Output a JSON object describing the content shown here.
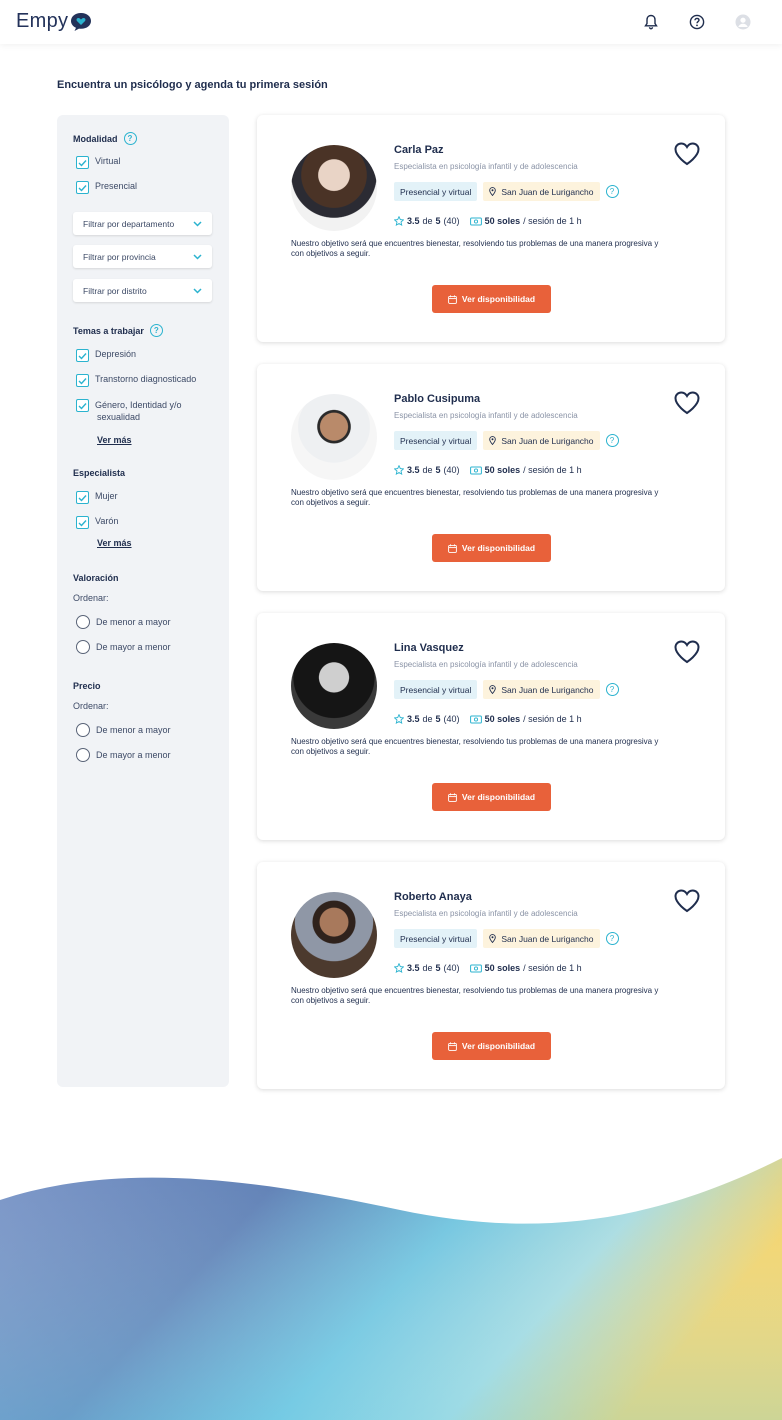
{
  "header": {
    "logo": "Empy"
  },
  "page_title": "Encuentra un psicólogo y agenda tu primera sesión",
  "filters": {
    "modalidad": {
      "label": "Modalidad",
      "options": [
        "Virtual",
        "Presencial"
      ]
    },
    "selects": [
      "Filtrar por departamento",
      "Filtrar por provincia",
      "Filtrar por distrito"
    ],
    "temas": {
      "label": "Temas a trabajar",
      "options": [
        "Depresión",
        "Transtorno diagnosticado",
        "Género, Identidad y/o",
        "sexualidad"
      ],
      "more": "Ver más"
    },
    "especialista": {
      "label": "Especialista",
      "options": [
        "Mujer",
        "Varón"
      ],
      "more": "Ver más"
    },
    "valoracion": {
      "label": "Valoración",
      "order_label": "Ordenar:",
      "options": [
        "De menor a mayor",
        "De mayor a menor"
      ]
    },
    "precio": {
      "label": "Precio",
      "order_label": "Ordenar:",
      "options": [
        "De menor a mayor",
        "De mayor a menor"
      ]
    }
  },
  "cards": [
    {
      "name": "Carla Paz",
      "specialty": "Especialista en psicología infantil y de adolescencia",
      "modality": "Presencial y virtual",
      "location": "San Juan de Lurigancho",
      "rating": "3.5",
      "of": "de",
      "max": "5",
      "reviews": "(40)",
      "price": "50 soles",
      "per": "/ sesión de 1 h",
      "description": "Nuestro objetivo será que encuentres bienestar, resolviendo tus problemas de una manera progresiva y con objetivos a seguir.",
      "button": "Ver disponibilidad"
    },
    {
      "name": "Pablo Cusipuma",
      "specialty": "Especialista en psicología infantil y de adolescencia",
      "modality": "Presencial y virtual",
      "location": "San Juan de Lurigancho",
      "rating": "3.5",
      "of": "de",
      "max": "5",
      "reviews": "(40)",
      "price": "50 soles",
      "per": "/ sesión de 1 h",
      "description": "Nuestro objetivo será que encuentres bienestar, resolviendo tus problemas de una manera progresiva y con objetivos a seguir.",
      "button": "Ver disponibilidad"
    },
    {
      "name": "Lina Vasquez",
      "specialty": "Especialista en psicología infantil y de adolescencia",
      "modality": "Presencial y virtual",
      "location": "San Juan de Lurigancho",
      "rating": "3.5",
      "of": "de",
      "max": "5",
      "reviews": "(40)",
      "price": "50 soles",
      "per": "/ sesión de 1 h",
      "description": "Nuestro objetivo será que encuentres bienestar, resolviendo tus problemas de una manera progresiva y con objetivos a seguir.",
      "button": "Ver disponibilidad"
    },
    {
      "name": "Roberto Anaya",
      "specialty": "Especialista en psicología infantil y de adolescencia",
      "modality": "Presencial y virtual",
      "location": "San Juan de Lurigancho",
      "rating": "3.5",
      "of": "de",
      "max": "5",
      "reviews": "(40)",
      "price": "50 soles",
      "per": "/ sesión de 1 h",
      "description": "Nuestro objetivo será que encuentres bienestar, resolviendo tus problemas de una manera progresiva y con objetivos a seguir.",
      "button": "Ver disponibilidad"
    }
  ],
  "icons": [
    "bell-icon",
    "help-icon",
    "user-avatar-icon",
    "check-icon",
    "chevron-down-icon",
    "star-icon",
    "money-icon",
    "location-pin-icon",
    "calendar-icon",
    "heart-icon"
  ],
  "colors": {
    "accent": "#2bb3cf",
    "button": "#e8613a",
    "navy": "#1f2d4d"
  }
}
